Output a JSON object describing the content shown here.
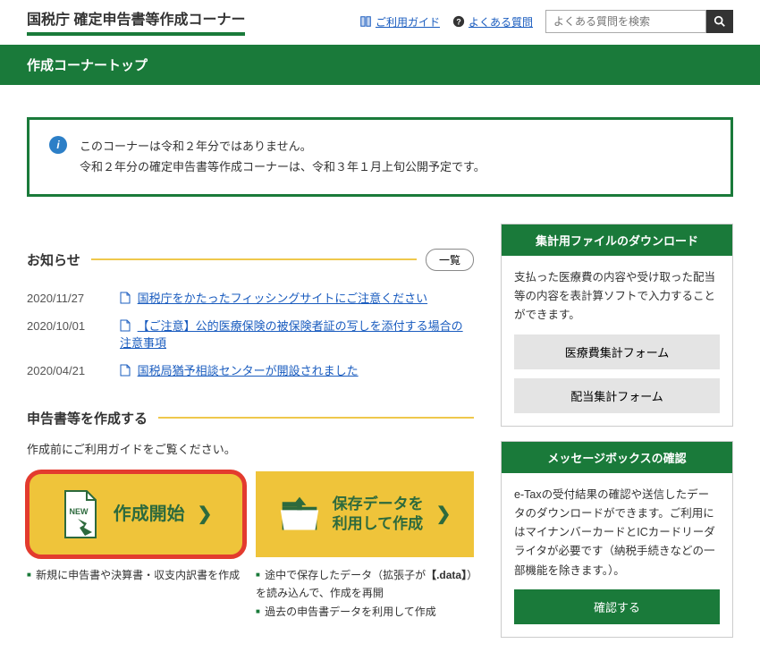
{
  "header": {
    "site_title": "国税庁 確定申告書等作成コーナー",
    "guide_label": "ご利用ガイド",
    "faq_label": "よくある質問",
    "search_placeholder": "よくある質問を検索"
  },
  "greenbar": {
    "title": "作成コーナートップ"
  },
  "info": {
    "line1": "このコーナーは令和２年分ではありません。",
    "line2": "令和２年分の確定申告書等作成コーナーは、令和３年１月上旬公開予定です。"
  },
  "news": {
    "heading": "お知らせ",
    "list_label": "一覧",
    "items": [
      {
        "date": "2020/11/27",
        "title": "国税庁をかたったフィッシングサイトにご注意ください"
      },
      {
        "date": "2020/10/01",
        "title": "【ご注意】公的医療保険の被保険者証の写しを添付する場合の注意事項"
      },
      {
        "date": "2020/04/21",
        "title": "国税局猶予相談センターが開設されました"
      }
    ]
  },
  "create": {
    "heading": "申告書等を作成する",
    "desc": "作成前にご利用ガイドをご覧ください。",
    "card1": {
      "badge": "NEW",
      "title": "作成開始",
      "note1": "新規に申告書や決算書・収支内訳書を作成"
    },
    "card2": {
      "title_l1": "保存データを",
      "title_l2": "利用して作成",
      "note1_a": "途中で保存したデータ（拡張子が",
      "note1_b": "【.data】",
      "note1_c": "）を読み込んで、作成を再開",
      "note2": "過去の申告書データを利用して作成"
    }
  },
  "side": {
    "widget1": {
      "title": "集計用ファイルのダウンロード",
      "body": "支払った医療費の内容や受け取った配当等の内容を表計算ソフトで入力することができます。",
      "btn1": "医療費集計フォーム",
      "btn2": "配当集計フォーム"
    },
    "widget2": {
      "title": "メッセージボックスの確認",
      "body": "e-Taxの受付結果の確認や送信したデータのダウンロードができます。ご利用にはマイナンバーカードとICカードリーダライタが必要です（納税手続きなどの一部機能を除きます。）。",
      "btn": "確認する"
    }
  }
}
